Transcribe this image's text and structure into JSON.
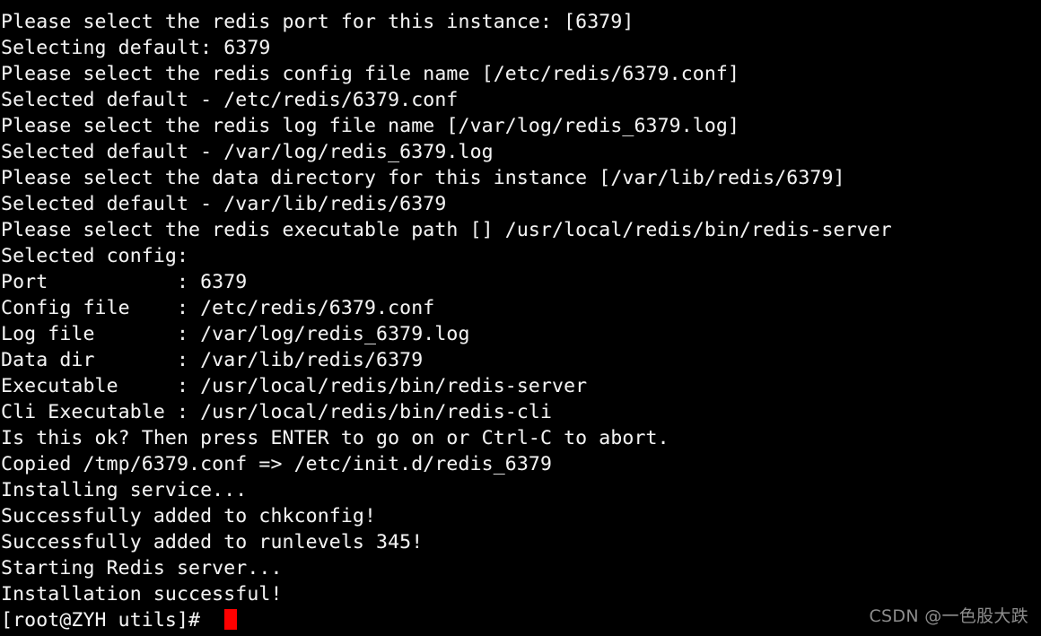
{
  "terminal": {
    "background_color": "#000000",
    "foreground_color": "#f2f2f2",
    "cursor_color": "#ff0000",
    "lines": [
      "Please select the redis port for this instance: [6379]",
      "Selecting default: 6379",
      "Please select the redis config file name [/etc/redis/6379.conf]",
      "Selected default - /etc/redis/6379.conf",
      "Please select the redis log file name [/var/log/redis_6379.log]",
      "Selected default - /var/log/redis_6379.log",
      "Please select the data directory for this instance [/var/lib/redis/6379]",
      "Selected default - /var/lib/redis/6379",
      "Please select the redis executable path [] /usr/local/redis/bin/redis-server",
      "Selected config:",
      "Port           : 6379",
      "Config file    : /etc/redis/6379.conf",
      "Log file       : /var/log/redis_6379.log",
      "Data dir       : /var/lib/redis/6379",
      "Executable     : /usr/local/redis/bin/redis-server",
      "Cli Executable : /usr/local/redis/bin/redis-cli",
      "Is this ok? Then press ENTER to go on or Ctrl-C to abort.",
      "Copied /tmp/6379.conf => /etc/init.d/redis_6379",
      "Installing service...",
      "Successfully added to chkconfig!",
      "Successfully added to runlevels 345!",
      "Starting Redis server...",
      "Installation successful!"
    ],
    "prompt": "[root@ZYH utils]# "
  },
  "watermark": {
    "text": "CSDN @一色股大跌"
  }
}
